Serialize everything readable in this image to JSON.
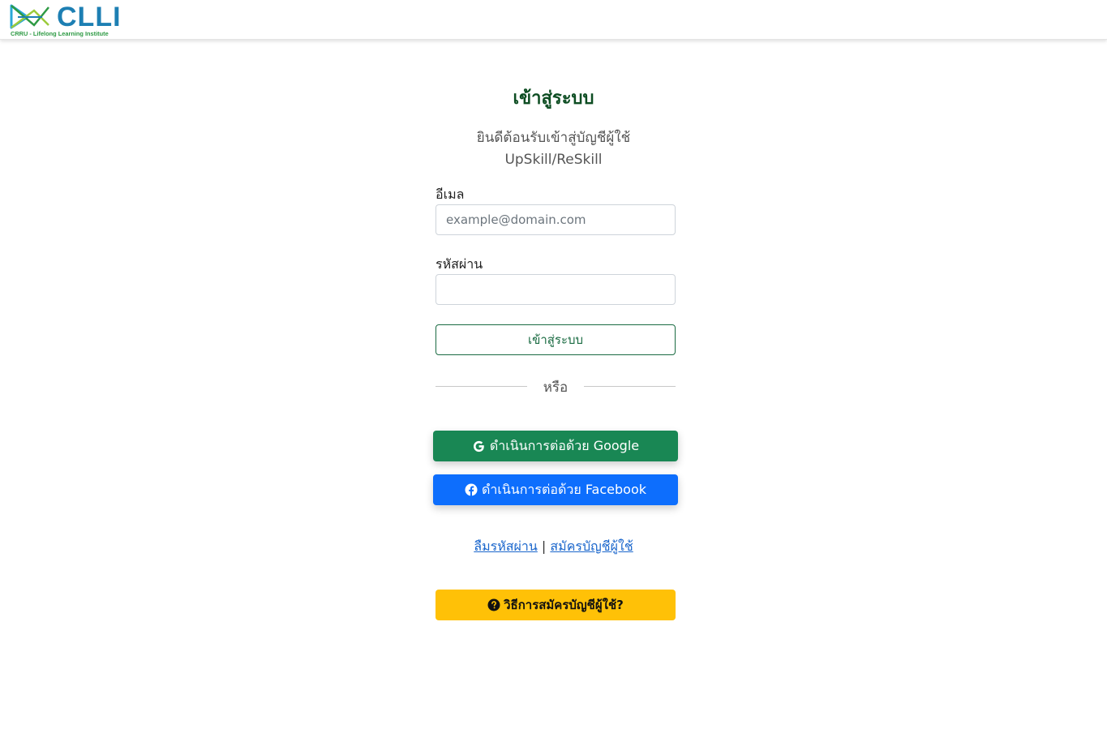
{
  "header": {
    "logo_text": "CLLI",
    "logo_subtitle": "CRRU - Lifelong Learning Institute"
  },
  "login": {
    "title": "เข้าสู่ระบบ",
    "welcome_line1": "ยินดีต้อนรับเข้าสู่บัญชีผู้ใช้",
    "welcome_line2": "UpSkill/ReSkill",
    "email_label": "อีเมล",
    "email_placeholder": "example@domain.com",
    "email_value": "",
    "password_label": "รหัสผ่าน",
    "password_value": "",
    "submit_label": "เข้าสู่ระบบ",
    "divider_text": "หรือ"
  },
  "social": {
    "google_label": "ดำเนินการต่อด้วย Google",
    "google_icon": "google-icon",
    "google_color": "#198754",
    "facebook_label": "ดำเนินการต่อด้วย Facebook",
    "facebook_icon": "facebook-icon",
    "facebook_color": "#0d6efd"
  },
  "links": {
    "forgot_password": "ลืมรหัสผ่าน",
    "separator": "|",
    "register": "สมัครบัญชีผู้ใช้"
  },
  "help": {
    "label": "วิธีการสมัครบัญชีผู้ใช้?",
    "icon": "question-circle-icon",
    "color": "#ffc107"
  },
  "colors": {
    "title_green": "#0d4d22",
    "link_blue": "#1a66cc"
  }
}
